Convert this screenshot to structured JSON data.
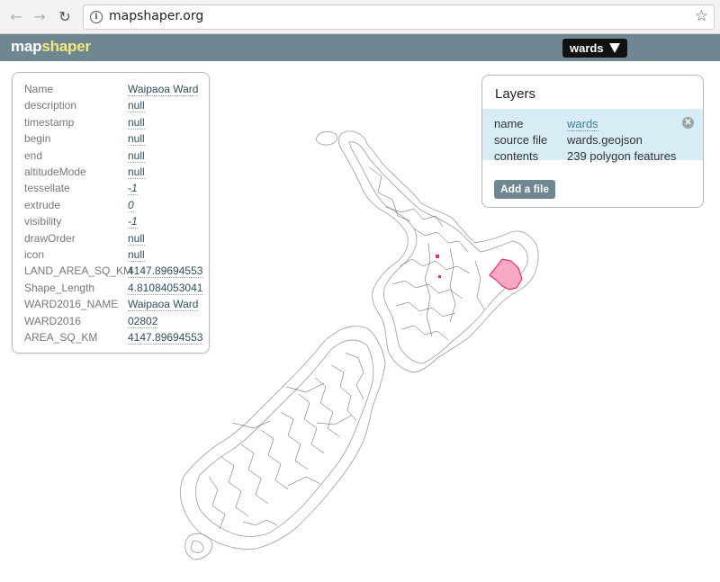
{
  "browser": {
    "back_icon": "arrow-left-icon",
    "forward_icon": "arrow-right-icon",
    "reload_icon": "reload-icon",
    "url": "mapshaper.org",
    "bookmark_icon": "star-icon"
  },
  "app": {
    "logo_part1": "map",
    "logo_part2": "shaper",
    "layer_selector": "wards",
    "header_color": "#6e8791",
    "logo_accent": "#f4e97a"
  },
  "popup": {
    "rows": [
      {
        "key": "Name",
        "value": "Waipaoa Ward"
      },
      {
        "key": "description",
        "value": "null"
      },
      {
        "key": "timestamp",
        "value": "null"
      },
      {
        "key": "begin",
        "value": "null"
      },
      {
        "key": "end",
        "value": "null"
      },
      {
        "key": "altitudeMode",
        "value": "null"
      },
      {
        "key": "tessellate",
        "value": "-1"
      },
      {
        "key": "extrude",
        "value": "0"
      },
      {
        "key": "visibility",
        "value": "-1"
      },
      {
        "key": "drawOrder",
        "value": "null"
      },
      {
        "key": "icon",
        "value": "null"
      },
      {
        "key": "LAND_AREA_SQ_KM",
        "value": "4147.89694553"
      },
      {
        "key": "Shape_Length",
        "value": "4.81084053041"
      },
      {
        "key": "WARD2016_NAME",
        "value": "Waipaoa Ward"
      },
      {
        "key": "WARD2016",
        "value": "02802"
      },
      {
        "key": "AREA_SQ_KM",
        "value": "4147.89694553"
      }
    ]
  },
  "layers": {
    "title": "Layers",
    "item": {
      "name_label": "name",
      "name_value": "wards",
      "source_label": "source file",
      "source_value": "wards.geojson",
      "contents_label": "contents",
      "contents_value": "239 polygon features"
    },
    "add_file": "Add a file",
    "selected_color": "#d7ecf5"
  },
  "map": {
    "selected_feature_color": "#f7a9c3",
    "selected_outline_color": "#e8316b"
  }
}
